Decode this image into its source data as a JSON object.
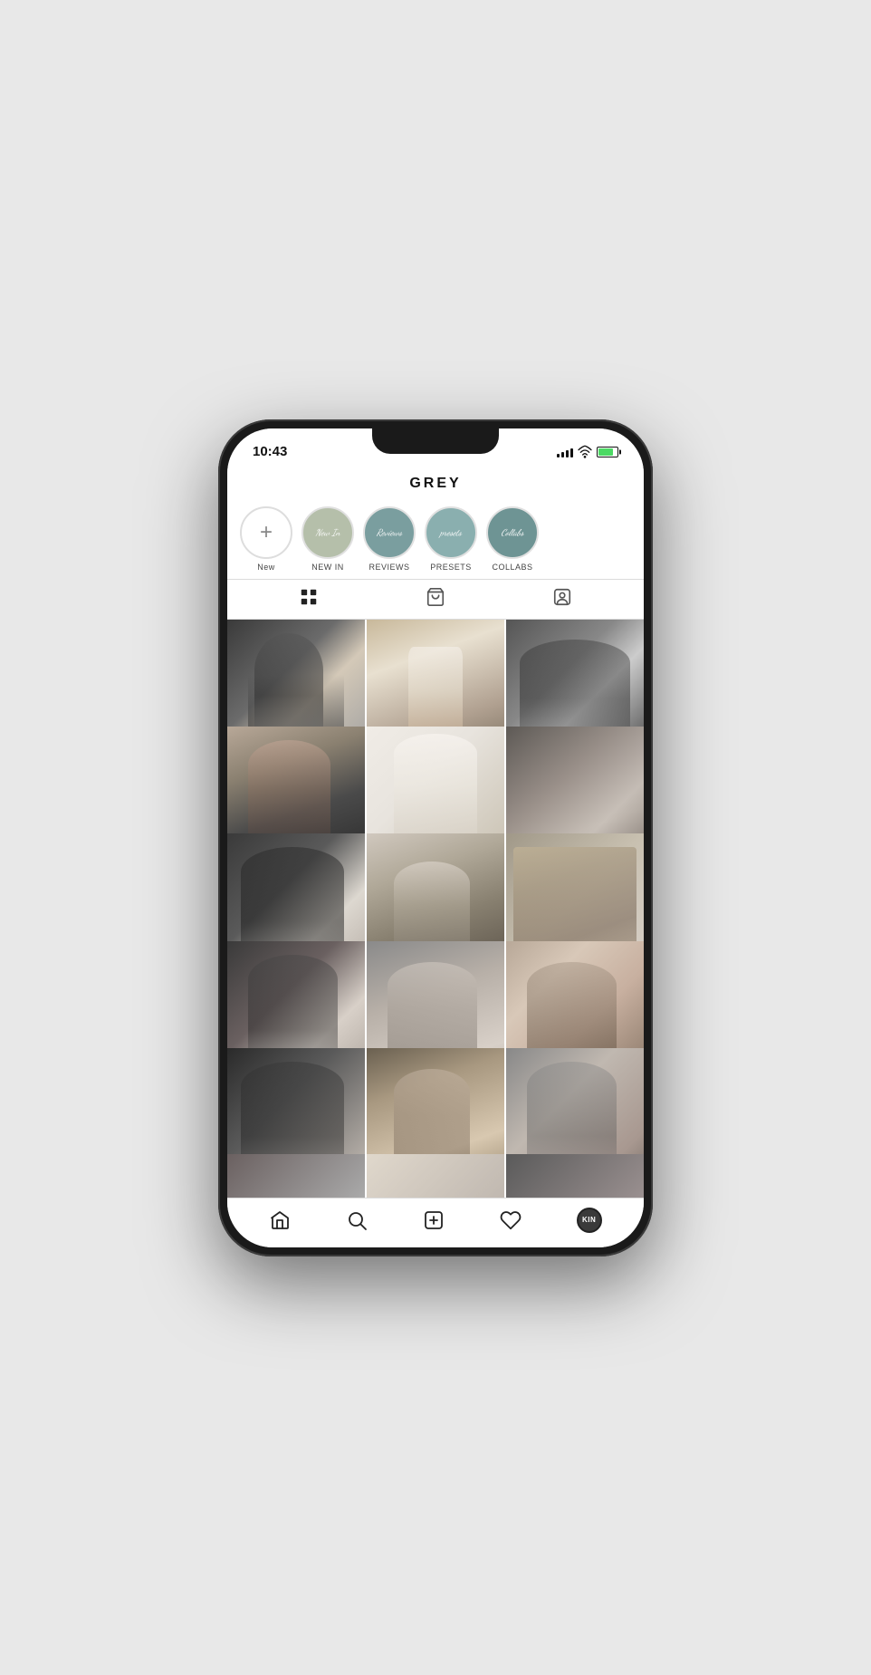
{
  "phone": {
    "status": {
      "time": "10:43"
    },
    "profile": {
      "username": "GREY"
    },
    "stories": [
      {
        "id": "new",
        "type": "new",
        "label": "New",
        "symbol": "+"
      },
      {
        "id": "new-in",
        "type": "sage",
        "label": "NEW IN",
        "text": "New In"
      },
      {
        "id": "reviews",
        "type": "teal",
        "label": "REVIEWS",
        "text": "Reviews"
      },
      {
        "id": "presets",
        "type": "muted-teal",
        "label": "PRESETS",
        "text": "presets"
      },
      {
        "id": "collabs",
        "type": "dusty-teal",
        "label": "COLLABS",
        "text": "Collabs"
      }
    ],
    "tabs": [
      "grid",
      "shop",
      "person"
    ],
    "photos": [
      {
        "id": 1,
        "class": "photo-1"
      },
      {
        "id": 2,
        "class": "photo-2"
      },
      {
        "id": 3,
        "class": "photo-3"
      },
      {
        "id": 4,
        "class": "photo-4"
      },
      {
        "id": 5,
        "class": "photo-5"
      },
      {
        "id": 6,
        "class": "photo-6"
      },
      {
        "id": 7,
        "class": "photo-7"
      },
      {
        "id": 8,
        "class": "photo-8"
      },
      {
        "id": 9,
        "class": "photo-9"
      },
      {
        "id": 10,
        "class": "photo-10"
      },
      {
        "id": 11,
        "class": "photo-11"
      },
      {
        "id": 12,
        "class": "photo-12"
      },
      {
        "id": 13,
        "class": "photo-13"
      },
      {
        "id": 14,
        "class": "photo-14"
      },
      {
        "id": 15,
        "class": "photo-15"
      }
    ],
    "nav": {
      "home_label": "Home",
      "search_label": "Search",
      "add_label": "Add",
      "likes_label": "Likes",
      "profile_label": "Profile",
      "profile_text": "KIN"
    }
  }
}
